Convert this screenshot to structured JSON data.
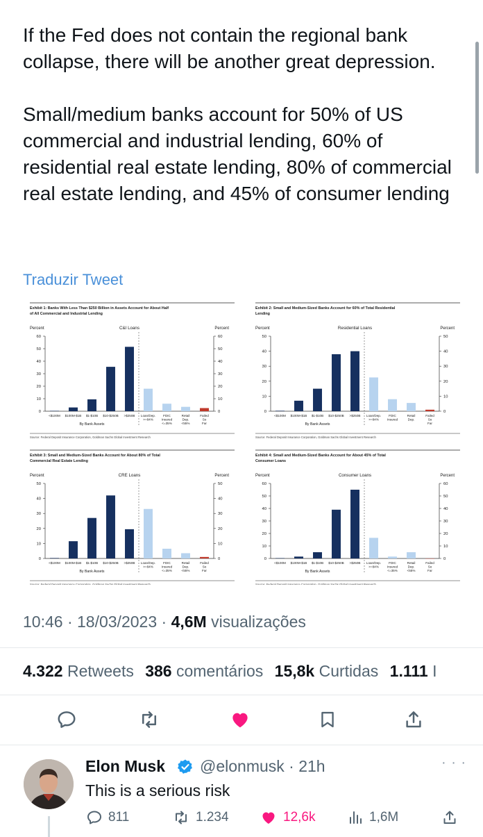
{
  "tweet": {
    "text": "If the Fed does not contain the regional bank collapse, there will be another great depression.\n\nSmall/medium banks account for 50% of US commercial and industrial lending, 60% of residential real estate lending, 80% of commercial real estate lending, and 45% of consumer lending",
    "translate_label": "Traduzir Tweet",
    "time": "10:46 · 18/03/2023 · ",
    "views_count": "4,6M",
    "views_label": " visualizações"
  },
  "stats": {
    "retweets_count": "4.322",
    "retweets_label": "Retweets",
    "comments_count": "386",
    "comments_label": "comentários",
    "likes_count": "15,8k",
    "likes_label": "Curtidas",
    "quotes_count": "1.111",
    "quotes_label": "I"
  },
  "actions": {
    "icons": [
      "reply-icon",
      "retweet-icon",
      "like-icon-filled",
      "bookmark-icon",
      "share-icon"
    ],
    "like_color": "#f91880"
  },
  "reply": {
    "name": "Elon Musk",
    "handle": "@elonmusk · 21h",
    "more": "· · ·",
    "text": "This is a serious risk",
    "replies": "811",
    "retweets": "1.234",
    "likes": "12,6k",
    "views": "1,6M"
  },
  "chart_data": [
    {
      "type": "bar",
      "title": "Exhibit 1: Banks With Less Than $250 Billion in Assets Account for About Half of All Commercial and Industrial Lending",
      "panel_label": "C&I Loans",
      "ylabel": "Percent",
      "xlabel": "By Bank Assets",
      "ylim": [
        0,
        60
      ],
      "yticks": [
        0,
        10,
        20,
        30,
        40,
        50,
        60
      ],
      "categories": [
        "<$100M",
        "$100M-$1B",
        "$1-$10B",
        "$10-$250B",
        ">$250B",
        "Loan/Dep. >=84%",
        "FDIC Insured <=35%",
        "Retail Dep. <55%",
        "Failed So Far"
      ],
      "values": [
        0.3,
        3,
        9.5,
        35.5,
        51.5,
        18,
        6,
        3.5,
        2.5
      ],
      "colors": [
        "#16305f",
        "#16305f",
        "#16305f",
        "#16305f",
        "#16305f",
        "#b7d3ef",
        "#b7d3ef",
        "#b7d3ef",
        "#c0392b"
      ],
      "source": "Source: Federal Deposit Insurance Corporation, Goldman Sachs Global Investment Research"
    },
    {
      "type": "bar",
      "title": "Exhibit 2: Small and Medium-Sized Banks Account for 60% of Total Residential Lending",
      "panel_label": "Residential Loans",
      "ylabel": "Percent",
      "xlabel": "By Bank Assets",
      "ylim": [
        0,
        50
      ],
      "yticks": [
        0,
        10,
        20,
        30,
        40,
        50
      ],
      "categories": [
        "<$100M",
        "$100M-$1B",
        "$1-$10B",
        "$10-$250B",
        ">$250B",
        "Loan/Dep. >=84%",
        "FDIC Insured",
        "Retail Dep.",
        "Failed So Far"
      ],
      "values": [
        0.3,
        7,
        15,
        38,
        40,
        22.5,
        8,
        5.5,
        1
      ],
      "colors": [
        "#16305f",
        "#16305f",
        "#16305f",
        "#16305f",
        "#16305f",
        "#b7d3ef",
        "#b7d3ef",
        "#b7d3ef",
        "#c0392b"
      ],
      "source": "Source: Federal Deposit Insurance Corporation, Goldman Sachs Global Investment Research"
    },
    {
      "type": "bar",
      "title": "Exhibit 3: Small and Medium-Sized Banks Account for About 80% of Total Commercial Real Estate Lending",
      "panel_label": "CRE Loans",
      "ylabel": "Percent",
      "xlabel": "By Bank Assets",
      "ylim": [
        0,
        50
      ],
      "yticks": [
        0,
        10,
        20,
        30,
        40,
        50
      ],
      "categories": [
        "<$100M",
        "$100M-$1B",
        "$1-$10B",
        "$10-$250B",
        ">$250B",
        "Loan/Dep. >=84%",
        "FDIC Insured <=35%",
        "Retail Dep. <55%",
        "Failed So Far"
      ],
      "values": [
        0.3,
        11.5,
        27,
        42,
        19.5,
        33,
        6.5,
        3.5,
        1
      ],
      "colors": [
        "#16305f",
        "#16305f",
        "#16305f",
        "#16305f",
        "#16305f",
        "#b7d3ef",
        "#b7d3ef",
        "#b7d3ef",
        "#c0392b"
      ],
      "source": "Source: Federal Deposit Insurance Corporation, Goldman Sachs Global Investment Research"
    },
    {
      "type": "bar",
      "title": "Exhibit 4: Small and Medium-Sized Banks Account for About 45% of Total Consumer Loans",
      "panel_label": "Consumer Loans",
      "ylabel": "Percent",
      "xlabel": "By Bank Assets",
      "ylim": [
        0,
        60
      ],
      "yticks": [
        0,
        10,
        20,
        30,
        40,
        50,
        60
      ],
      "categories": [
        "<$100M",
        "$100M-$1B",
        "$1-$10B",
        "$10-$250B",
        ">$250B",
        "Loan/Dep. >=84%",
        "FDIC Insured <=35%",
        "Retail Dep. <55%",
        "Failed So Far"
      ],
      "values": [
        0.3,
        1.5,
        5,
        39,
        55,
        16.5,
        1.5,
        5,
        0
      ],
      "colors": [
        "#16305f",
        "#16305f",
        "#16305f",
        "#16305f",
        "#16305f",
        "#b7d3ef",
        "#b7d3ef",
        "#b7d3ef",
        "#c0392b"
      ],
      "source": "Source: Federal Deposit Insurance Corporation, Goldman Sachs Global Investment Research"
    }
  ]
}
